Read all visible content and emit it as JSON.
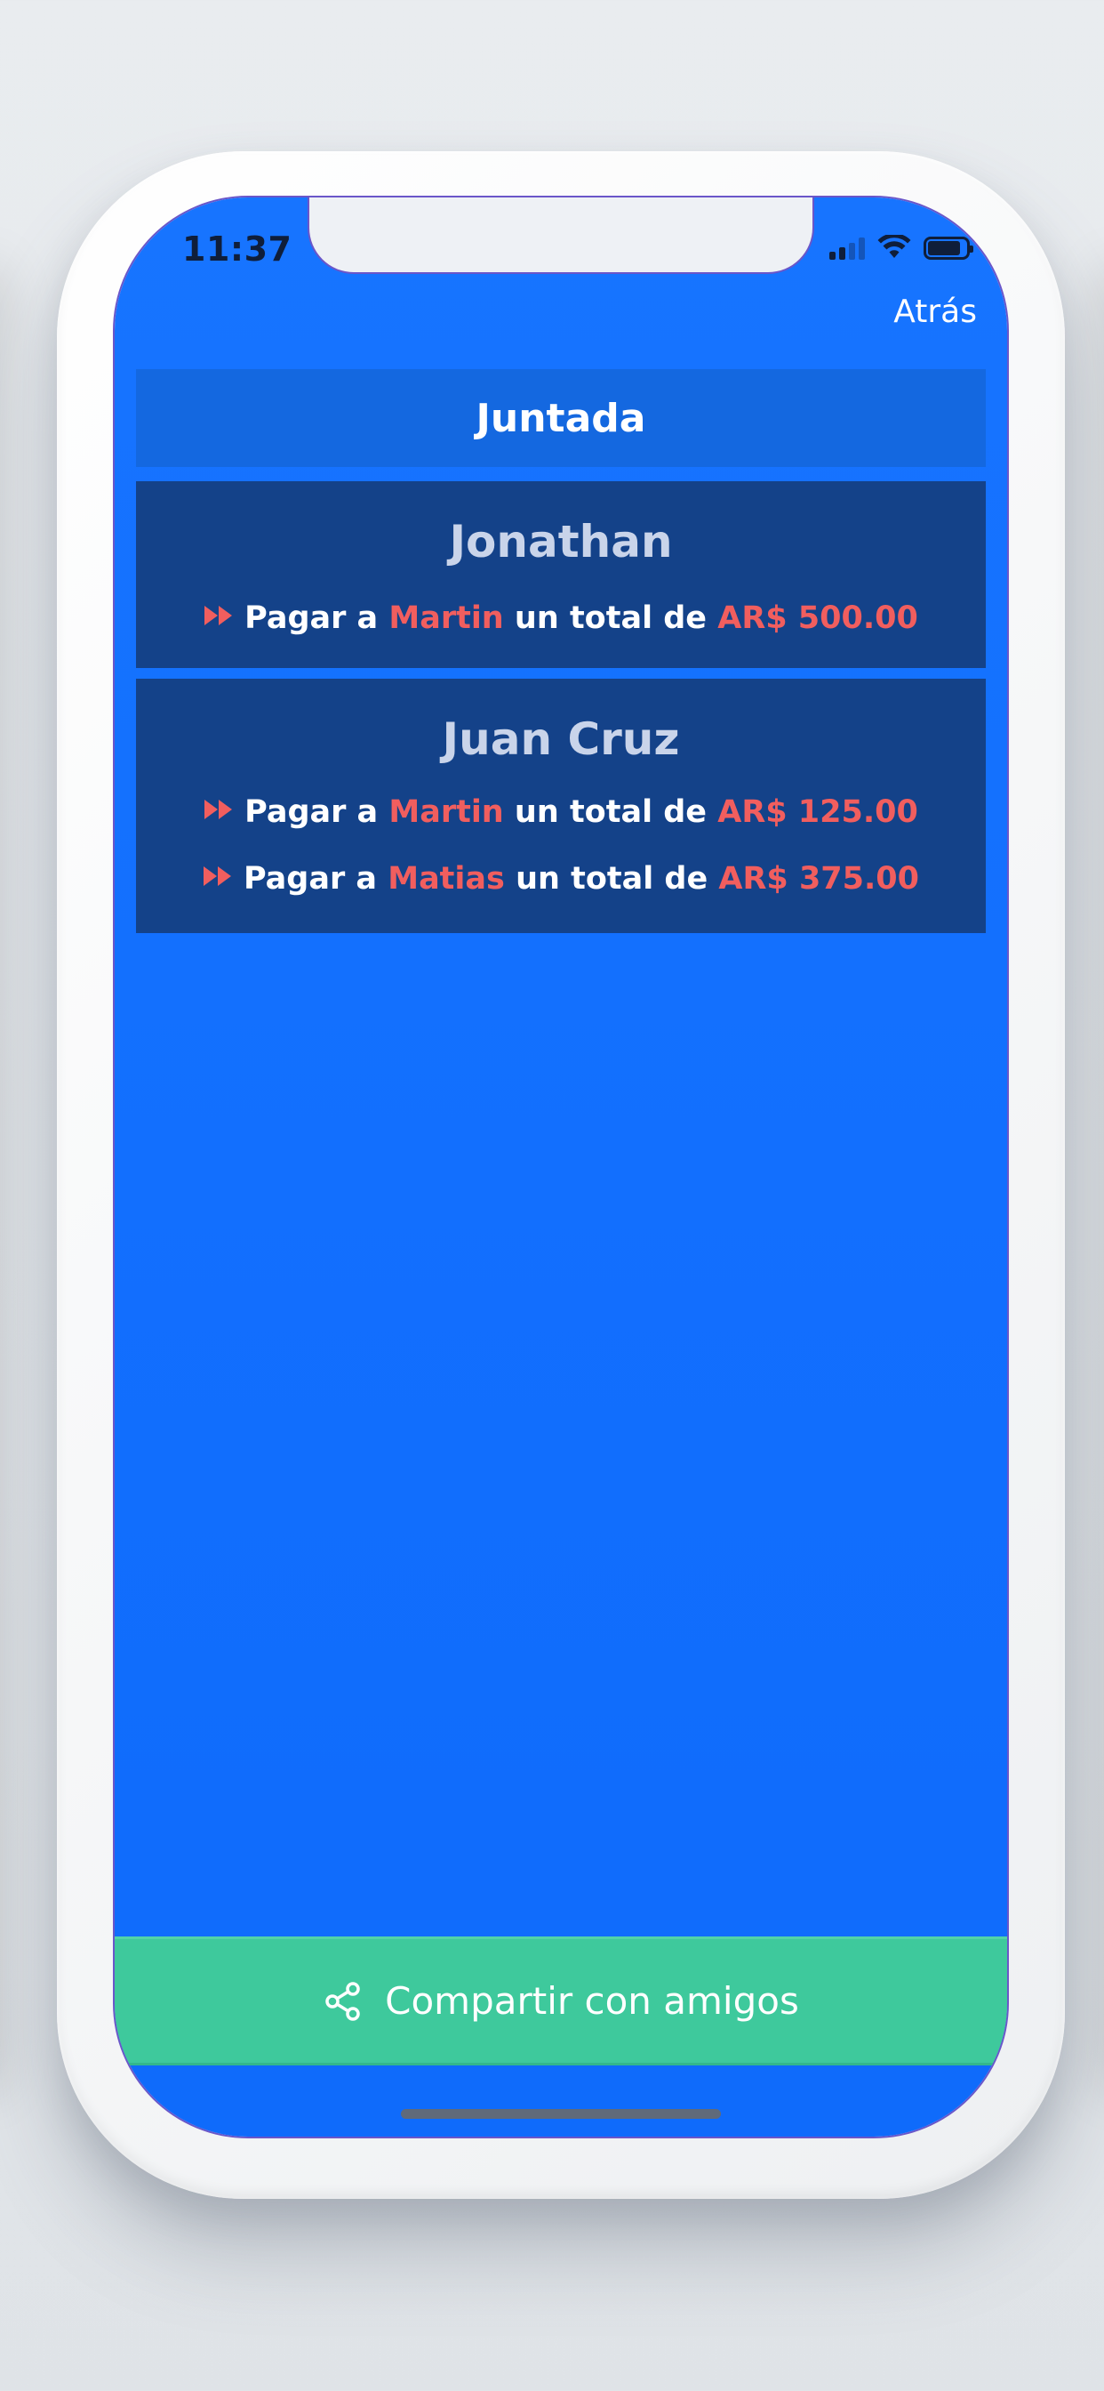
{
  "status_bar": {
    "time": "11:37",
    "icons": [
      "cellular-signal-icon",
      "wifi-icon",
      "battery-icon"
    ]
  },
  "nav": {
    "back_label": "Atrás"
  },
  "event": {
    "title": "Juntada"
  },
  "debts": [
    {
      "debtor": "Jonathan",
      "payments": [
        {
          "prefix": "Pagar a",
          "creditor": "Martin",
          "middle": "un total de",
          "amount": "AR$ 500.00"
        }
      ]
    },
    {
      "debtor": "Juan Cruz",
      "payments": [
        {
          "prefix": "Pagar a",
          "creditor": "Martin",
          "middle": "un total de",
          "amount": "AR$ 125.00"
        },
        {
          "prefix": "Pagar a",
          "creditor": "Matias",
          "middle": "un total de",
          "amount": "AR$ 375.00"
        }
      ]
    }
  ],
  "share": {
    "label": "Compartir con amigos",
    "icon": "share-icon"
  },
  "colors": {
    "screen_bg": "#126ffe",
    "title_bar": "#1468e0",
    "card_bg": "#144289",
    "highlight": "#f15e5e",
    "share_button": "#3ec99c"
  }
}
